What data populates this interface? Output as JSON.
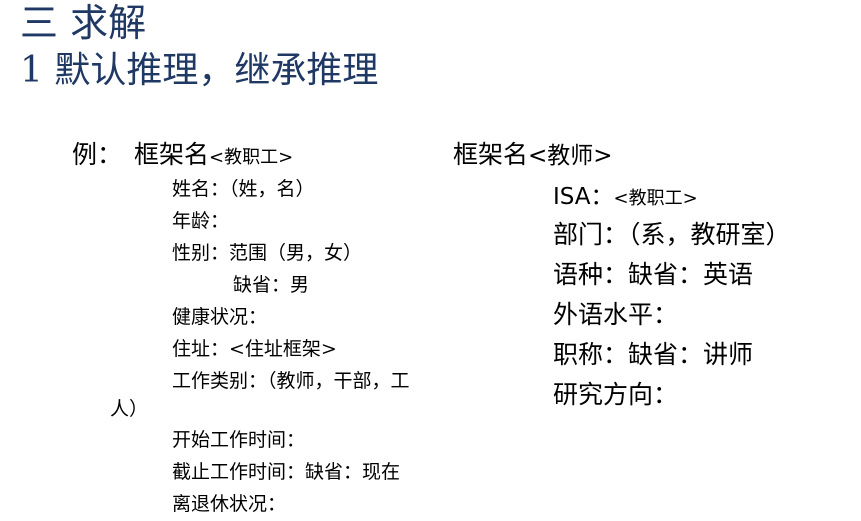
{
  "slide": {
    "heading": "三 求解",
    "subheading": "1 默认推理，继承推理"
  },
  "left_frame": {
    "example_label": "例：",
    "frame_prefix": "框架名",
    "frame_name": "<教职工>",
    "slots": [
      "姓名：（姓，名）",
      "年龄：",
      "性别：范围（男，女）",
      "缺省：男",
      "健康状况：",
      "住址：<住址框架>",
      "工作类别：（教师，干部，工",
      "人）",
      "开始工作时间：",
      "截止工作时间：缺省：现在",
      "离退休状况："
    ]
  },
  "right_frame": {
    "frame_prefix": "框架名",
    "frame_name": "<教师>",
    "isa_label": "ISA：",
    "isa_value": "<教职工>",
    "slots": [
      "部门：（系，教研室）",
      "语种：缺省：英语",
      "外语水平：",
      "职称：缺省：讲师",
      "研究方向："
    ]
  }
}
